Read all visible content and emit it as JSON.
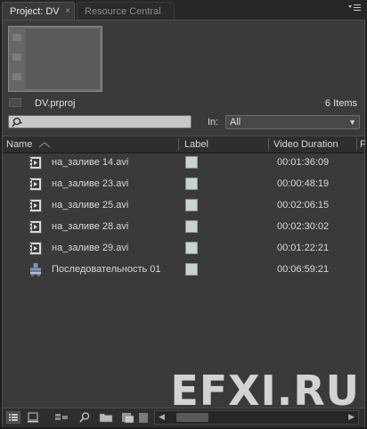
{
  "tabs": [
    {
      "label": "Project: DV",
      "active": true
    },
    {
      "label": "Resource Central",
      "active": false
    }
  ],
  "tab_close_glyph": "×",
  "panel_menu_icon": "panel-menu-icon",
  "project": {
    "file_name": "DV.prproj",
    "item_count": "6 Items"
  },
  "search": {
    "value": "",
    "in_label": "In:",
    "in_value": "All"
  },
  "columns": {
    "name": "Name",
    "label": "Label",
    "video_duration": "Video Duration",
    "next_partial": "F"
  },
  "items": [
    {
      "name": "на_заливе 14.avi",
      "duration": "00:01:36:09",
      "icon": "video-clip-icon"
    },
    {
      "name": "на_заливе 23.avi",
      "duration": "00:00:48:19",
      "icon": "video-clip-icon"
    },
    {
      "name": "на_заливе 25.avi",
      "duration": "00:02:06:15",
      "icon": "video-clip-icon"
    },
    {
      "name": "на_заливе 28.avi",
      "duration": "00:02:30:02",
      "icon": "video-clip-icon"
    },
    {
      "name": "на_заливе 29.avi",
      "duration": "00:01:22:21",
      "icon": "video-clip-icon"
    },
    {
      "name": "Последовательность 01",
      "duration": "00:06:59:21",
      "icon": "sequence-icon"
    }
  ],
  "label_color": "#c8d4d0",
  "toolbar": {
    "buttons": [
      "list-view-icon",
      "icon-view-icon",
      "automate-to-sequence-icon",
      "find-icon",
      "new-bin-icon",
      "new-item-icon",
      "clear-icon"
    ]
  },
  "watermark": "EFXI.RU"
}
